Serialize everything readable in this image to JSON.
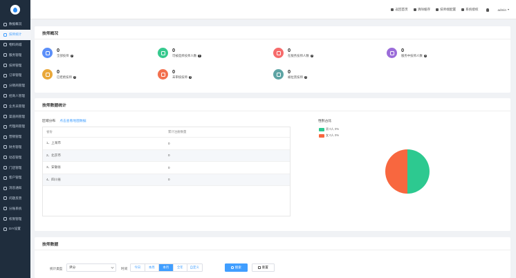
{
  "sidebar": {
    "items": [
      {
        "label": "数据概况",
        "active": false
      },
      {
        "label": "技师统计",
        "active": true
      },
      {
        "label": "物料商城",
        "active": false
      },
      {
        "label": "服务管理",
        "active": false
      },
      {
        "label": "技师管理",
        "active": false
      },
      {
        "label": "订单管理",
        "active": false
      },
      {
        "label": "分销商管理",
        "active": false
      },
      {
        "label": "招商人管理",
        "active": false
      },
      {
        "label": "业务员管理",
        "active": false
      },
      {
        "label": "渠道商管理",
        "active": false
      },
      {
        "label": "代理商管理",
        "active": false
      },
      {
        "label": "营销管理",
        "active": false
      },
      {
        "label": "财务管理",
        "active": false
      },
      {
        "label": "动态管理",
        "active": false
      },
      {
        "label": "门店管理",
        "active": false
      },
      {
        "label": "客户管理",
        "active": false
      },
      {
        "label": "消息通知",
        "active": false
      },
      {
        "label": "问题反馈",
        "active": false
      },
      {
        "label": "分账系统",
        "active": false
      },
      {
        "label": "权限管理",
        "active": false
      },
      {
        "label": "DIY设置",
        "active": false
      }
    ]
  },
  "topbar": {
    "links": [
      "返回首页",
      "清除缓存",
      "技师端配置",
      "系统授权"
    ],
    "user": "admin"
  },
  "overview": {
    "title": "技师概况",
    "stats": [
      {
        "value": "0",
        "label": "全部技师",
        "color": "#5b8ff9"
      },
      {
        "value": "0",
        "label": "可被选择技师人数",
        "color": "#36c98e"
      },
      {
        "value": "0",
        "label": "在服务技师人数",
        "color": "#f66b6b"
      },
      {
        "value": "0",
        "label": "服务中技师人数",
        "color": "#9b6cd9"
      },
      {
        "value": "0",
        "label": "已拒绝技师",
        "color": "#e9a83a"
      },
      {
        "value": "0",
        "label": "未审核技师",
        "color": "#f2704e"
      },
      {
        "value": "0",
        "label": "被拉黑技师",
        "color": "#5da4a4"
      }
    ]
  },
  "stats_section": {
    "title": "技师数据统计",
    "region_title": "区域分布",
    "region_link": "点击查看地图数据",
    "table_headers": [
      "省份",
      "累计注册数量"
    ],
    "rows": [
      {
        "province": "1、上海市",
        "count": "0"
      },
      {
        "province": "2、北京市",
        "count": "0"
      },
      {
        "province": "3、安徽省",
        "count": "0"
      },
      {
        "province": "4、四川省",
        "count": "0"
      }
    ],
    "gender_title": "性别占比",
    "legend": [
      {
        "label": "男  0人  0%",
        "color": "#2dc990"
      },
      {
        "label": "女  0人  0%",
        "color": "#f8673f"
      }
    ]
  },
  "tech_data": {
    "title": "技师数据",
    "filter_label": "统计类型",
    "filter_value": "评分",
    "time_label": "时间",
    "time_options": [
      {
        "label": "今日",
        "active": false
      },
      {
        "label": "本周",
        "active": false
      },
      {
        "label": "本月",
        "active": true
      },
      {
        "label": "全年",
        "active": false
      },
      {
        "label": "自定义",
        "active": false
      }
    ],
    "search_label": "搜索",
    "reset_label": "重置"
  }
}
